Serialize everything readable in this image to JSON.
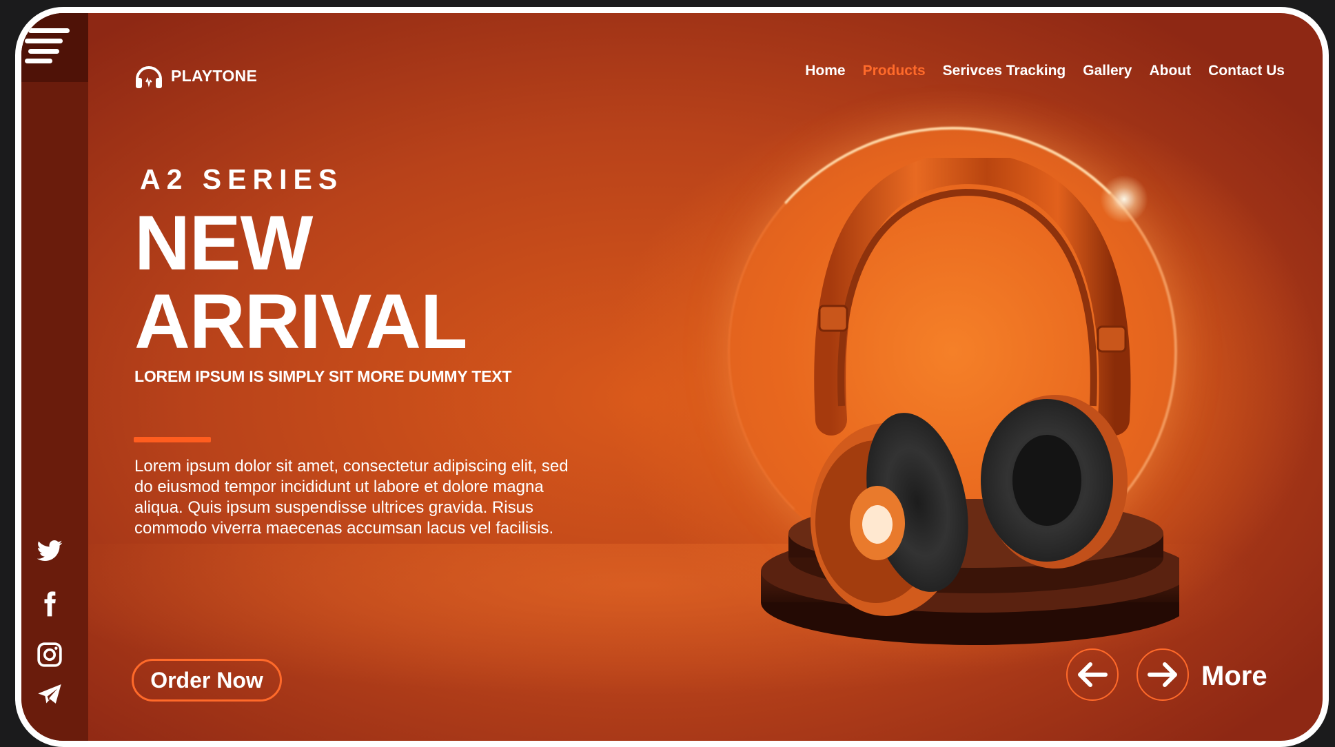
{
  "brand": {
    "name": "PLAYTONE",
    "logo_icon": "headphones-icon"
  },
  "nav": {
    "items": [
      {
        "label": "Home",
        "active": false
      },
      {
        "label": "Products",
        "active": true
      },
      {
        "label": "Serivces Tracking",
        "active": false
      },
      {
        "label": "Gallery",
        "active": false
      },
      {
        "label": "About",
        "active": false
      },
      {
        "label": "Contact Us",
        "active": false
      }
    ]
  },
  "hero": {
    "series": "A2 SERIES",
    "headline_line1": "NEW",
    "headline_line2": "ARRIVAL",
    "tagline": "LOREM IPSUM IS SIMPLY SIT MORE DUMMY TEXT",
    "body": "Lorem ipsum dolor sit amet, consectetur adipiscing elit, sed do eiusmod tempor incididunt ut labore et dolore magna aliqua. Quis ipsum suspendisse ultrices gravida. Risus commodo viverra maecenas accumsan lacus vel facilisis.",
    "cta_label": "Order Now"
  },
  "carousel": {
    "prev_icon": "arrow-left-icon",
    "next_icon": "arrow-right-icon",
    "more_label": "More"
  },
  "sidebar": {
    "menu_icon": "hamburger-menu-icon",
    "social": [
      "twitter-icon",
      "facebook-icon",
      "instagram-icon",
      "telegram-icon"
    ]
  },
  "colors": {
    "accent": "#ff6a2a",
    "sidebar": "#6a1c0c",
    "sidebar_top": "#4f1207",
    "background": "#d9591b",
    "frame": "#ffffff"
  }
}
